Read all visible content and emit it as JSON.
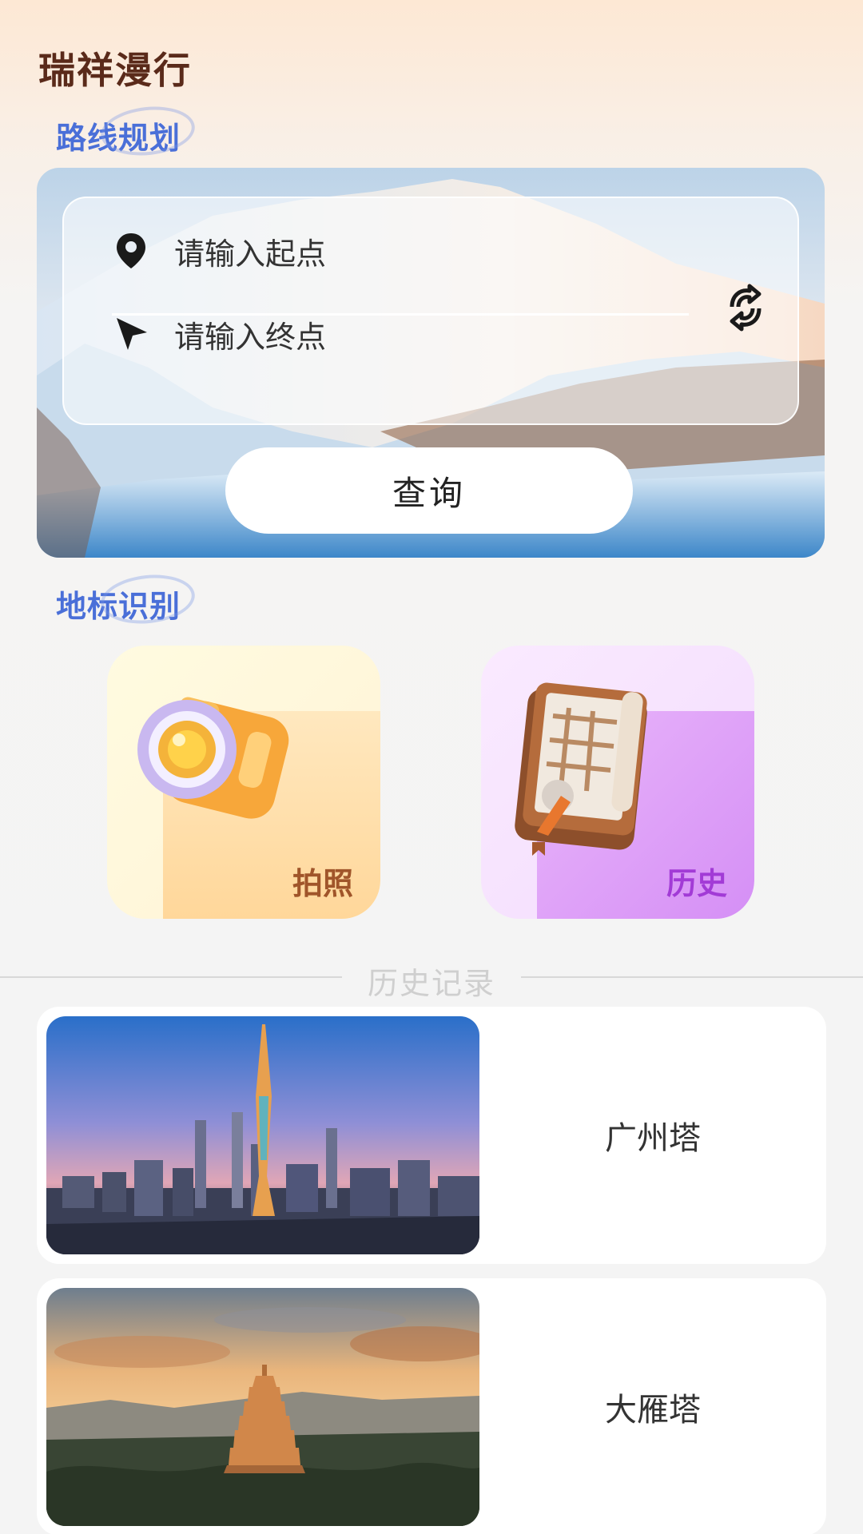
{
  "app": {
    "title": "瑞祥漫行"
  },
  "route": {
    "section_label": "路线规划",
    "start_placeholder": "请输入起点",
    "end_placeholder": "请输入终点",
    "query_label": "查询"
  },
  "landmark": {
    "section_label": "地标识别",
    "tiles": [
      {
        "label": "拍照",
        "icon": "camera-icon"
      },
      {
        "label": "历史",
        "icon": "history-book-icon"
      }
    ]
  },
  "history": {
    "title": "历史记录",
    "items": [
      {
        "name": "广州塔"
      },
      {
        "name": "大雁塔"
      }
    ]
  },
  "colors": {
    "title": "#5a2a1a",
    "section_label": "#4a6fd8",
    "photo_label": "#a0552a",
    "history_label": "#a23bd6"
  }
}
